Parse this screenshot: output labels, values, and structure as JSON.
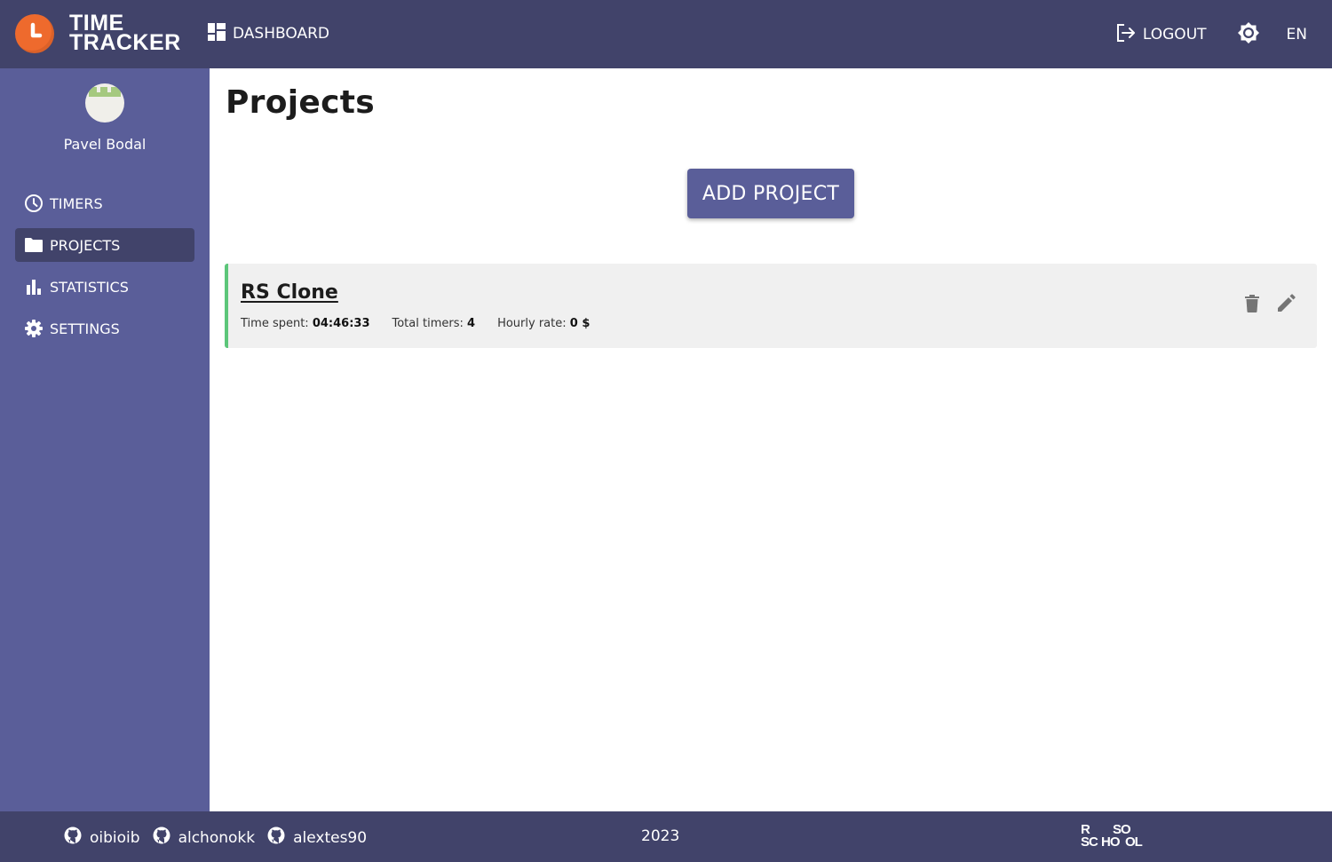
{
  "header": {
    "logo_line1": "TIME",
    "logo_line2": "TRACKER",
    "dashboard_label": "DASHBOARD",
    "logout_label": "LOGOUT",
    "language": "EN",
    "colors": {
      "background": "#41436a",
      "logo": "#ee6a2d"
    }
  },
  "sidebar": {
    "username": "Pavel Bodal",
    "items": [
      {
        "label": "TIMERS",
        "icon": "clock-icon",
        "active": false
      },
      {
        "label": "PROJECTS",
        "icon": "folder-icon",
        "active": true
      },
      {
        "label": "STATISTICS",
        "icon": "bar-chart-icon",
        "active": false
      },
      {
        "label": "SETTINGS",
        "icon": "gear-icon",
        "active": false
      }
    ],
    "colors": {
      "background": "#5a5e99",
      "active": "#41436a"
    }
  },
  "main": {
    "title": "Projects",
    "add_button_label": "ADD PROJECT",
    "projects": [
      {
        "name": "RS Clone",
        "time_spent_label": "Time spent:",
        "time_spent": "04:46:33",
        "total_timers_label": "Total timers:",
        "total_timers": "4",
        "hourly_rate_label": "Hourly rate:",
        "hourly_rate": "0 $",
        "accent_color": "#5cc67a"
      }
    ]
  },
  "footer": {
    "authors": [
      "oibioib",
      "alchonokk",
      "alextes90"
    ],
    "year": "2023",
    "school_logo_text": "RS SCHOOL"
  }
}
